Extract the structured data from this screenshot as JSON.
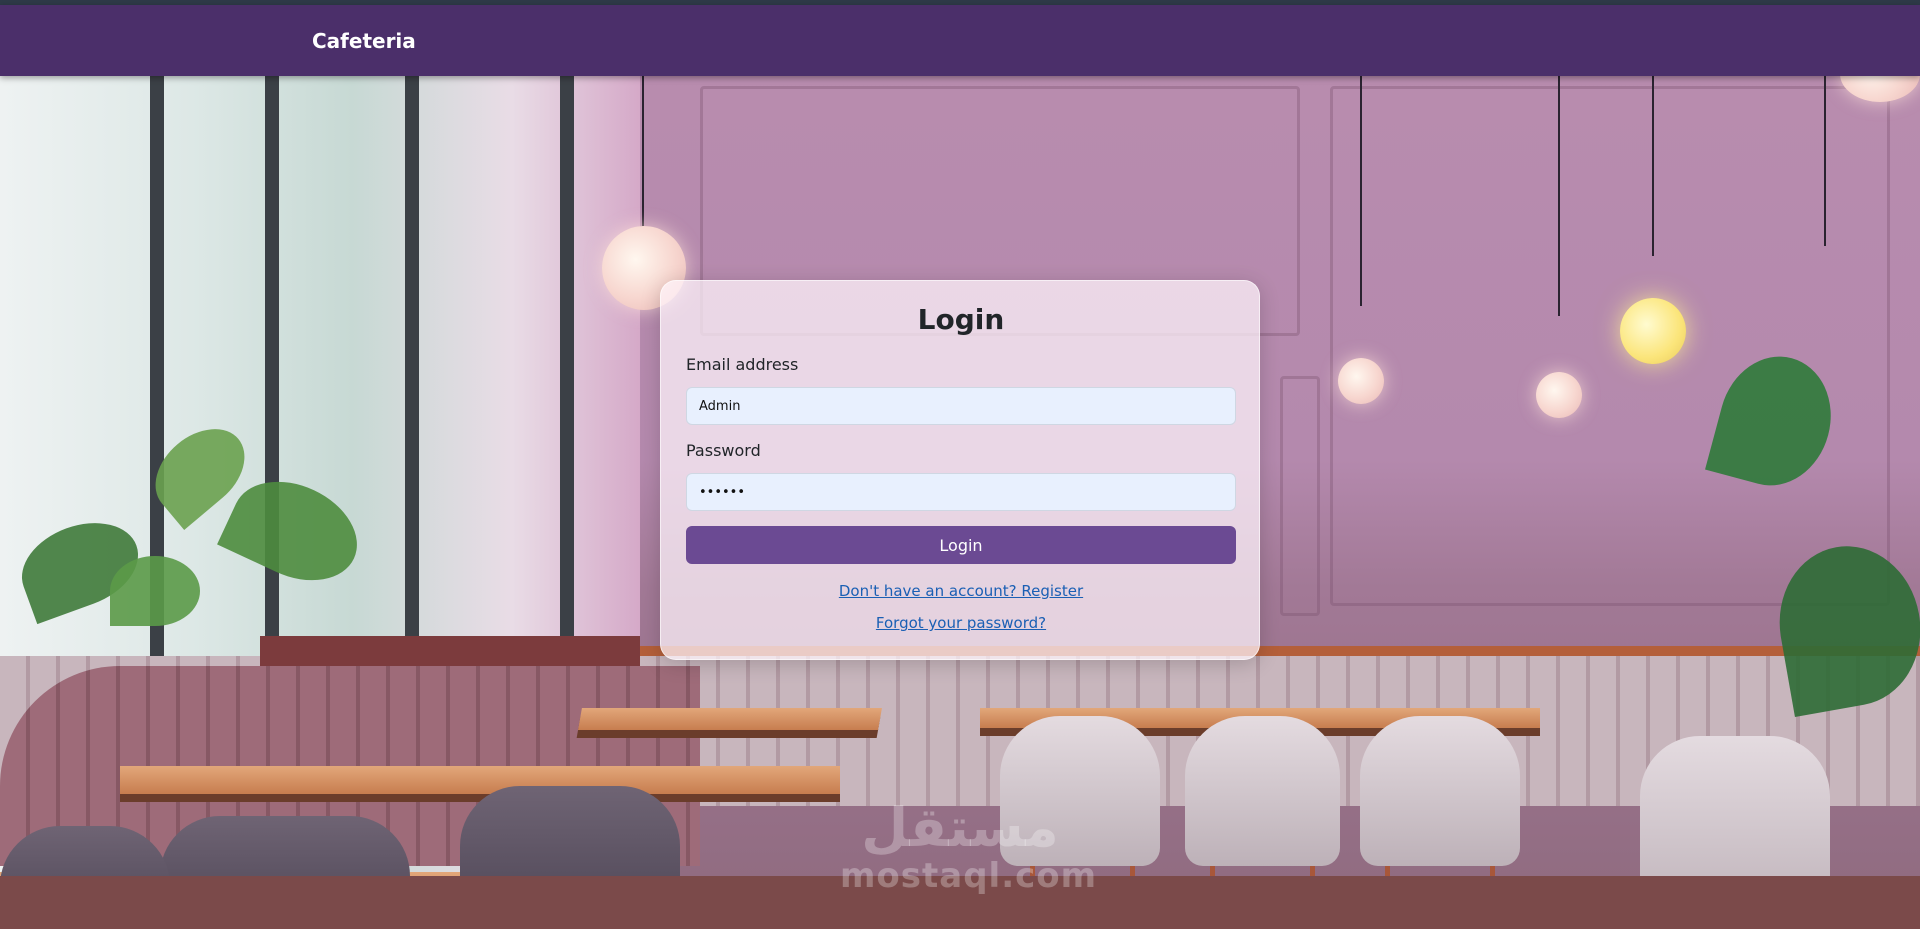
{
  "navbar": {
    "brand": "Cafeteria"
  },
  "login_form": {
    "title": "Login",
    "email_label": "Email address",
    "email_value": "Admin",
    "password_label": "Password",
    "password_value": "••••••",
    "submit_label": "Login",
    "register_link": "Don't have an account? Register",
    "forgot_link": "Forgot your password?"
  },
  "watermark": {
    "arabic": "مستقل",
    "latin": "mostaql.com"
  },
  "colors": {
    "navbar_bg": "#4b2f6a",
    "button_bg": "#6b4a93",
    "link": "#1a5fb4",
    "input_bg": "#e8f0fe"
  }
}
